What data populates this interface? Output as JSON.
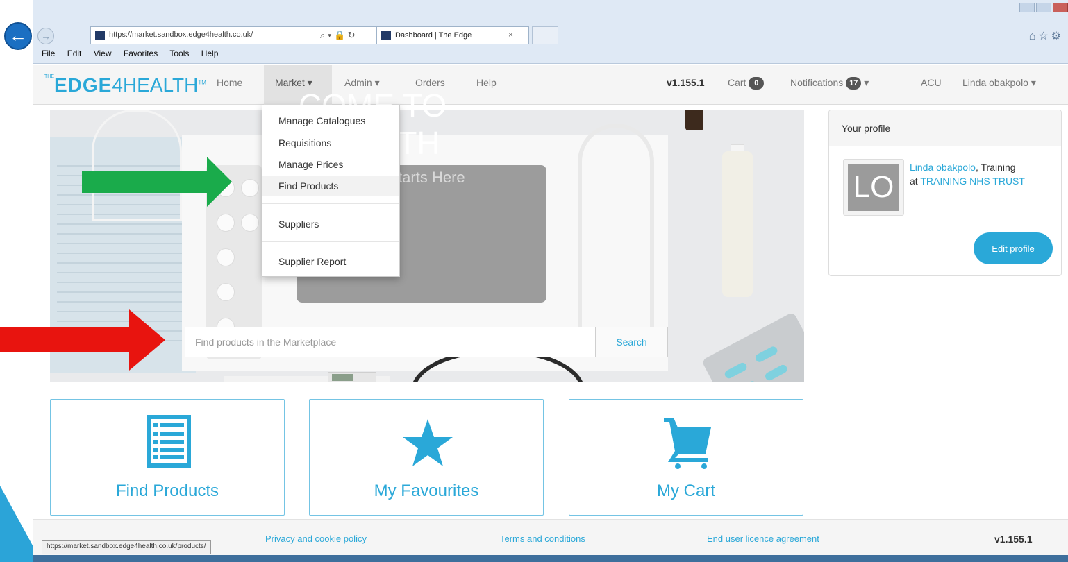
{
  "browser": {
    "url": "https://market.sandbox.edge4health.co.uk/",
    "tab_title": "Dashboard | The Edge",
    "tab_close": "×",
    "address_controls": "⌕ ▾ 🔒 ↻",
    "menu": [
      "File",
      "Edit",
      "View",
      "Favorites",
      "Tools",
      "Help"
    ],
    "status_url": "https://market.sandbox.edge4health.co.uk/products/"
  },
  "navbar": {
    "brand_prefix": "THE",
    "brand_bold": "EDGE",
    "brand_four": "4",
    "brand_rest": "HEALTH",
    "brand_tm": "TM",
    "home": "Home",
    "market": "Market ▾",
    "admin": "Admin ▾",
    "orders": "Orders",
    "help": "Help",
    "version": "v1.155.1",
    "cart_label": "Cart",
    "cart_count": "0",
    "notifications_label": "Notifications",
    "notifications_count": "17",
    "notifications_caret": "▾",
    "acu": "ACU",
    "user": "Linda obakpolo ▾"
  },
  "market_menu": {
    "items": [
      "Manage Catalogues",
      "Requisitions",
      "Manage Prices",
      "Find Products",
      "Suppliers",
      "Supplier Report"
    ],
    "highlighted": "Find Products"
  },
  "hero": {
    "title_line1": "COME TO",
    "title_line2": "4HEALTH",
    "subtitle": "Your Search Starts Here",
    "search_placeholder": "Find products in the Marketplace",
    "search_button": "Search"
  },
  "profile": {
    "heading": "Your profile",
    "initials": "LO",
    "name": "Linda obakpolo",
    "role_suffix": ", Training",
    "at": "at ",
    "org": "TRAINING NHS TRUST",
    "edit_button": "Edit profile"
  },
  "tiles": [
    {
      "label": "Find Products",
      "icon": "list-icon"
    },
    {
      "label": "My Favourites",
      "icon": "star-icon"
    },
    {
      "label": "My Cart",
      "icon": "cart-icon"
    }
  ],
  "footer": {
    "privacy": "Privacy and cookie policy",
    "terms": "Terms and conditions",
    "eula": "End user licence agreement",
    "version": "v1.155.1"
  },
  "colors": {
    "accent": "#2aa8d8",
    "green_arrow": "#1aab4b",
    "red_arrow": "#e8140f"
  }
}
